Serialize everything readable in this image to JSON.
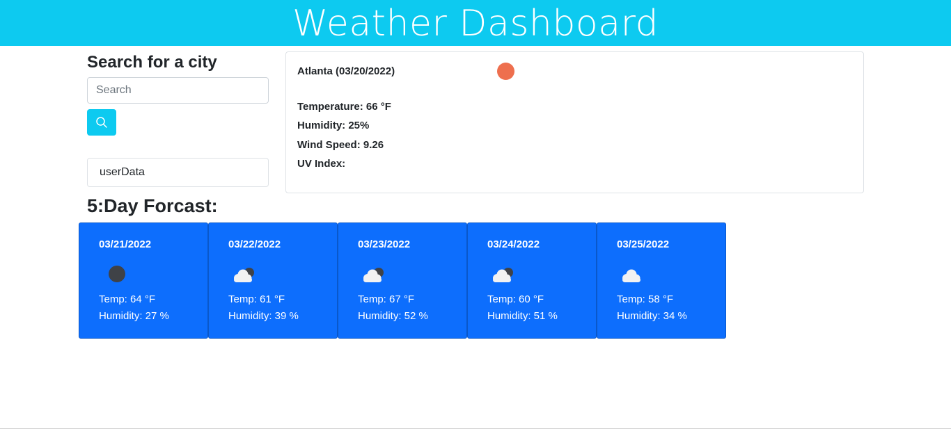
{
  "header": {
    "title": "Weather Dashboard"
  },
  "search": {
    "title": "Search for a city",
    "placeholder": "Search",
    "value": "",
    "button_icon": "search-icon"
  },
  "history": {
    "items": [
      "userData"
    ]
  },
  "current": {
    "city_date": "Atlanta (03/20/2022)",
    "icon": "sun-icon",
    "icon_color": "#ee6f4e",
    "temperature": "Temperature: 66 °F",
    "humidity": "Humidity: 25%",
    "wind": "Wind Speed: 9.26",
    "uv": "UV Index:"
  },
  "forecast": {
    "title": "5:Day Forcast:",
    "card_color": "#0d6efd",
    "days": [
      {
        "date": "03/21/2022",
        "icon": "moon-icon",
        "temp": "Temp: 64 °F",
        "humidity": "Humidity: 27 %"
      },
      {
        "date": "03/22/2022",
        "icon": "cloud-moon-icon",
        "temp": "Temp: 61 °F",
        "humidity": "Humidity: 39 %"
      },
      {
        "date": "03/23/2022",
        "icon": "cloud-moon-icon",
        "temp": "Temp: 67 °F",
        "humidity": "Humidity: 52 %"
      },
      {
        "date": "03/24/2022",
        "icon": "cloud-moon-icon",
        "temp": "Temp: 60 °F",
        "humidity": "Humidity: 51 %"
      },
      {
        "date": "03/25/2022",
        "icon": "cloud-icon",
        "temp": "Temp: 58 °F",
        "humidity": "Humidity: 34 %"
      }
    ]
  },
  "colors": {
    "banner": "#0dcaf0",
    "search_button": "#0dcaf0"
  }
}
